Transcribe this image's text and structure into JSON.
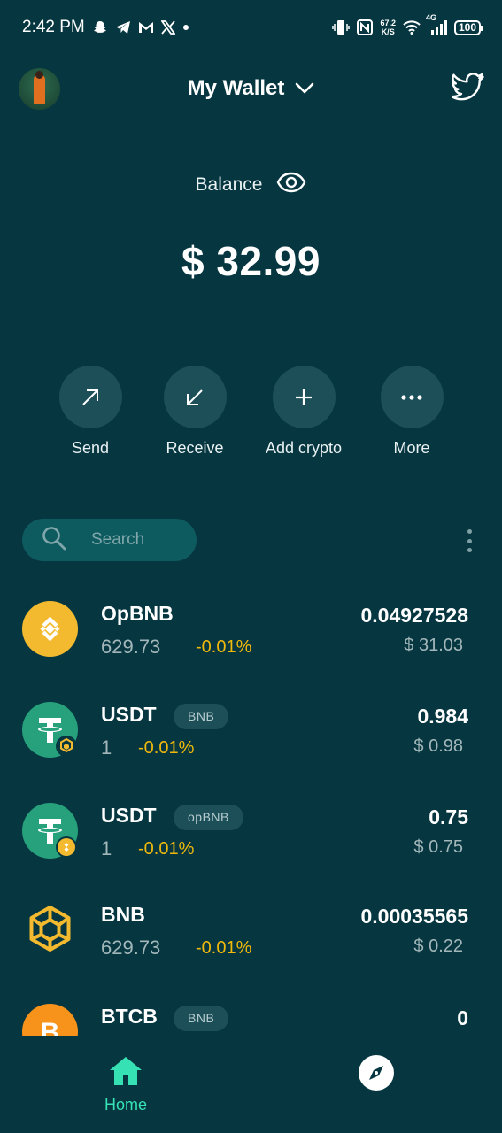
{
  "status_bar": {
    "time": "2:42 PM",
    "network_speed_value": "67.2",
    "network_speed_unit": "K/S",
    "network_type": "4G",
    "battery": "100",
    "icons": [
      "snapchat-icon",
      "telegram-icon",
      "gmail-icon",
      "x-icon",
      "dot-icon",
      "vibrate-icon",
      "nfc-icon",
      "wifi-icon",
      "signal-icon",
      "battery-icon"
    ]
  },
  "header": {
    "title": "My Wallet",
    "icons": [
      "avatar",
      "chevron-down-icon",
      "twitter-icon"
    ]
  },
  "balance": {
    "label": "Balance",
    "value": "$ 32.99"
  },
  "actions": [
    {
      "label": "Send",
      "icon": "arrow-up-right-icon"
    },
    {
      "label": "Receive",
      "icon": "arrow-down-left-icon"
    },
    {
      "label": "Add crypto",
      "icon": "plus-icon"
    },
    {
      "label": "More",
      "icon": "more-horizontal-icon"
    }
  ],
  "search": {
    "placeholder": "Search"
  },
  "tokens": [
    {
      "name": "OpBNB",
      "network": "",
      "price": "629.73",
      "change": "-0.01%",
      "amount": "0.04927528",
      "fiat": "$ 31.03"
    },
    {
      "name": "USDT",
      "network": "BNB",
      "price": "1",
      "change": "-0.01%",
      "amount": "0.984",
      "fiat": "$ 0.98"
    },
    {
      "name": "USDT",
      "network": "opBNB",
      "price": "1",
      "change": "-0.01%",
      "amount": "0.75",
      "fiat": "$ 0.75"
    },
    {
      "name": "BNB",
      "network": "",
      "price": "629.73",
      "change": "-0.01%",
      "amount": "0.00035565",
      "fiat": "$ 0.22"
    },
    {
      "name": "BTCB",
      "network": "BNB",
      "price": "",
      "change": "",
      "amount": "0",
      "fiat": ""
    }
  ],
  "bottom_nav": {
    "home_label": "Home",
    "active_color": "#36e2b4"
  },
  "colors": {
    "background": "#063741",
    "button": "#1c4f58",
    "accent": "#36e2b4",
    "change_negative": "#f0b90b",
    "bnb_yellow": "#f3ba2f",
    "tether_green": "#26a17b"
  }
}
